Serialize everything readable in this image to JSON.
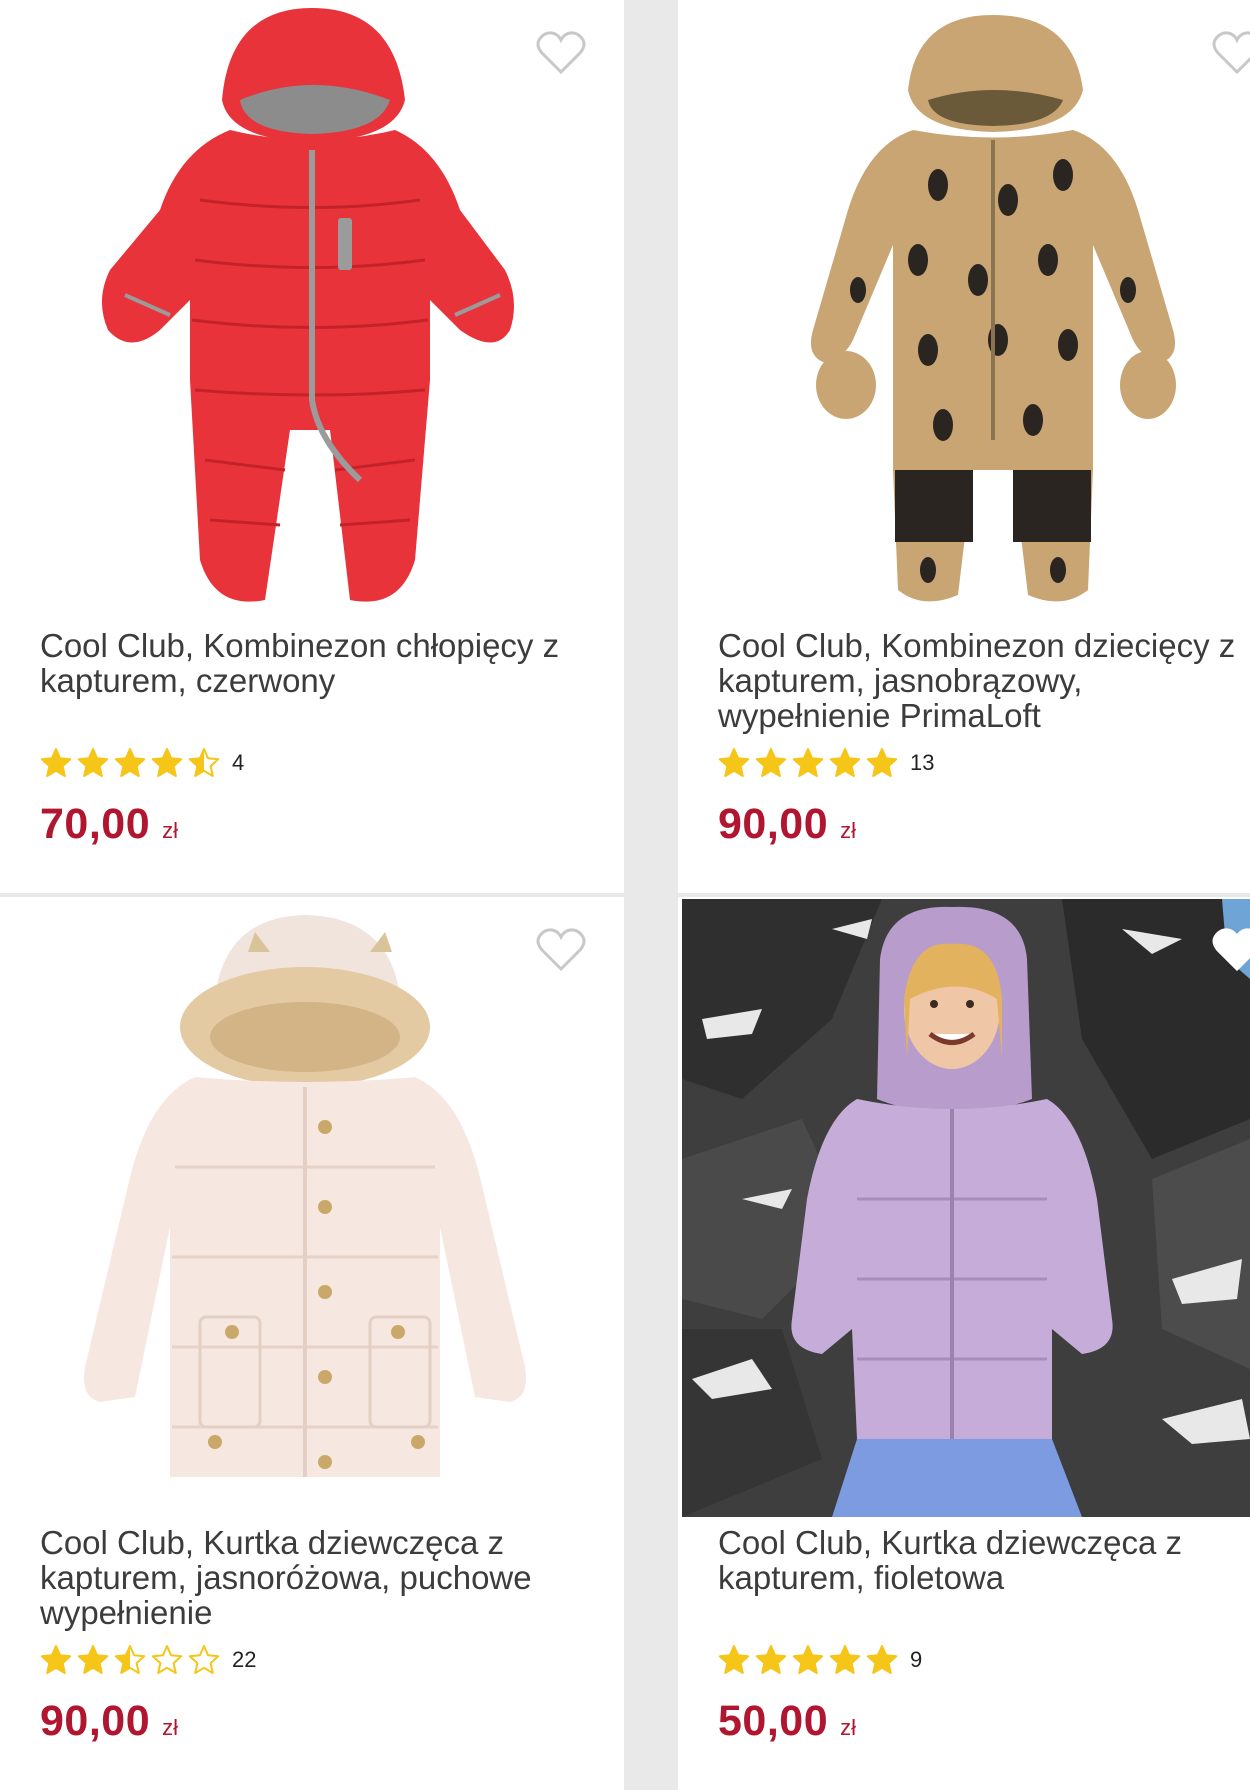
{
  "colors": {
    "price": "#b01630",
    "star": "#f5c518",
    "title": "#3c3c3c",
    "background": "#e9e9e9"
  },
  "products": [
    {
      "title": "Cool Club, Kombinezon chłopięcy z kapturem, czerwony",
      "rating": 4.5,
      "reviews": "4",
      "price": "70,00",
      "currency": "zł",
      "image": "red-snowsuit-image"
    },
    {
      "title": "Cool Club, Kombinezon dziecięcy z kapturem, jasnobrązowy, wypełnienie PrimaLoft",
      "rating": 5,
      "reviews": "13",
      "price": "90,00",
      "currency": "zł",
      "image": "penguin-snowsuit-image"
    },
    {
      "title": "Cool Club, Kurtka dziewczęca z kapturem, jasnoróżowa, puchowe wypełnienie",
      "rating": 2.5,
      "reviews": "22",
      "price": "90,00",
      "currency": "zł",
      "image": "pink-jacket-image"
    },
    {
      "title": "Cool Club, Kurtka dziewczęca z kapturem, fioletowa",
      "rating": 5,
      "reviews": "9",
      "price": "50,00",
      "currency": "zł",
      "image": "purple-jacket-photo"
    }
  ]
}
